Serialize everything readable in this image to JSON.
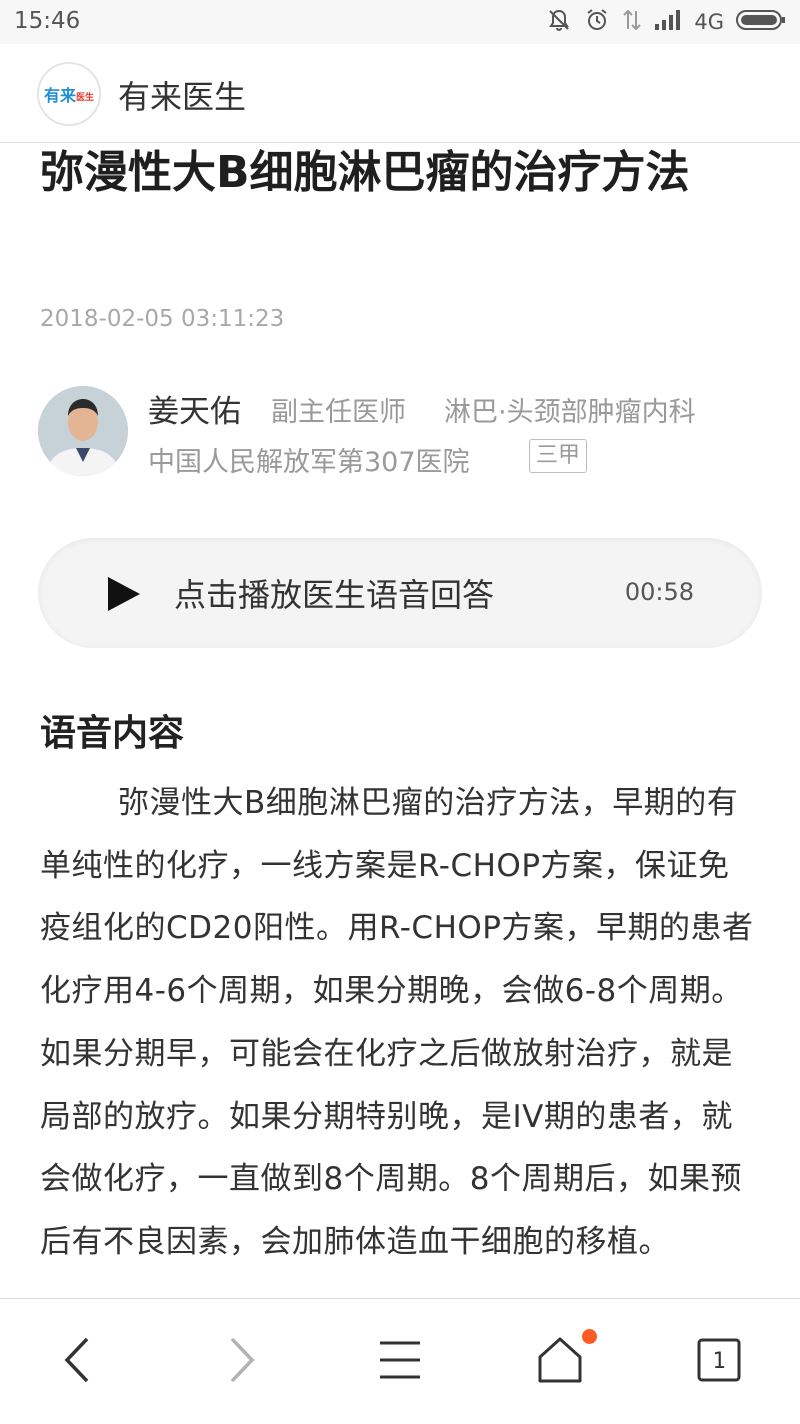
{
  "status_bar": {
    "time": "15:46",
    "network": "4G",
    "icons": [
      "mute-bell-icon",
      "alarm-clock-icon",
      "data-transfer-icon",
      "signal-icon",
      "battery-icon"
    ]
  },
  "app": {
    "name": "有来医生",
    "logo_text_main": "有来",
    "logo_text_accent": "医生"
  },
  "article": {
    "title": "弥漫性大B细胞淋巴瘤的治疗方法",
    "date": "2018-02-05 03:11:23",
    "author": {
      "name": "姜天佑",
      "title": "副主任医师",
      "department": "淋巴·头颈部肿瘤内科",
      "hospital": "中国人民解放军第307医院",
      "hospital_grade": "三甲"
    },
    "audio": {
      "label": "点击播放医生语音回答",
      "duration": "00:58"
    },
    "section_heading": "语音内容",
    "body": "弥漫性大B细胞淋巴瘤的治疗方法，早期的有单纯性的化疗，一线方案是R-CHOP方案，保证免疫组化的CD20阳性。用R-CHOP方案，早期的患者化疗用4-6个周期，如果分期晚，会做6-8个周期。如果分期早，可能会在化疗之后做放射治疗，就是局部的放疗。如果分期特别晚，是IV期的患者，就会做化疗，一直做到8个周期。8个周期后，如果预后有不良因素，会加肺体造血干细胞的移植。"
  },
  "bottom_nav": {
    "items": [
      "back-icon",
      "forward-icon",
      "menu-icon",
      "home-icon",
      "tabs-icon"
    ],
    "tab_count": "1",
    "home_notification": true
  },
  "colors": {
    "accent_blue": "#1e8fd8",
    "accent_red": "#e63c2e",
    "notification_dot": "#ff5a24",
    "muted_text": "#9a9a9a"
  }
}
